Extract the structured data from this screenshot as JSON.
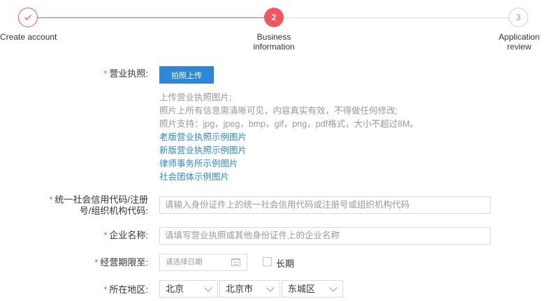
{
  "stepper": {
    "steps": [
      {
        "number": "",
        "label": "Create account",
        "state": "done",
        "icon": "check-icon"
      },
      {
        "number": "2",
        "label": "Business information",
        "state": "active"
      },
      {
        "number": "3",
        "label": "Application review",
        "state": "pending"
      }
    ],
    "colors": {
      "active": "#f0575e",
      "pending": "#d9d9d9"
    }
  },
  "form": {
    "license": {
      "label": "营业执照:",
      "upload_button": "拍照上传",
      "notes": [
        "上传营业执照图片;",
        "照片上所有信息需清晰可见，内容真实有效，不得做任何修改;",
        "照片支持：jpg，jpeg，bmp，gif，png，pdf格式，大小不超过8M。"
      ],
      "links": [
        "老版营业执照示例图片",
        "新版营业执照示例图片",
        "律师事务所示例图片",
        "社会团体示例图片"
      ]
    },
    "credit_code": {
      "label_line1": "统一社会信用代码/注册",
      "label_line2": "号/组织机构代码:",
      "placeholder": "请输入身份证件上的统一社会信用代码或注册号或组织机构代码"
    },
    "company_name": {
      "label": "企业名称:",
      "placeholder": "请填写营业执照或其他身份证件上的企业名称"
    },
    "term": {
      "label": "经营期限至:",
      "placeholder": "请选择日期",
      "long_term_label": "长期"
    },
    "region": {
      "label": "所在地区:",
      "province": "北京",
      "city": "北京市",
      "district": "东城区"
    }
  },
  "accent_color": "#2d86d8",
  "required_color": "#f0575e"
}
